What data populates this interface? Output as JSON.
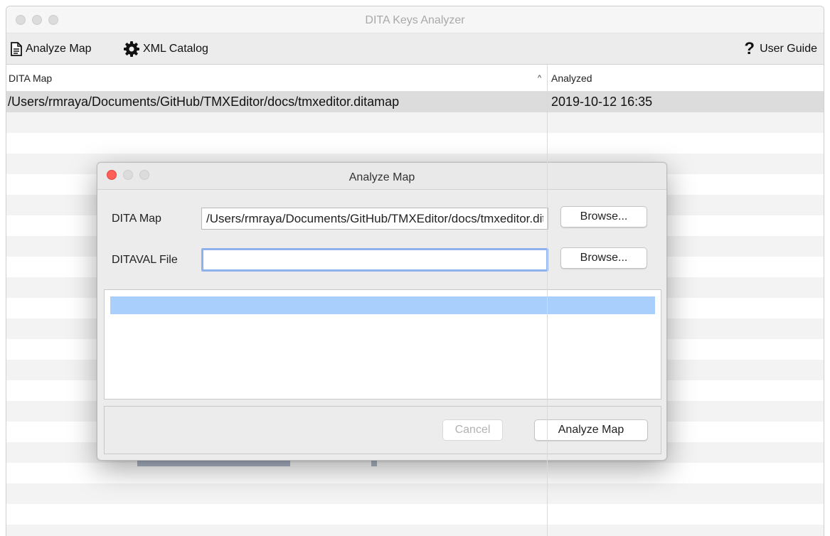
{
  "window": {
    "title": "DITA Keys Analyzer"
  },
  "toolbar": {
    "analyze_map": {
      "label": "Analyze Map",
      "icon": "document-icon"
    },
    "xml_catalog": {
      "label": "XML Catalog",
      "icon": "gear-icon"
    },
    "user_guide": {
      "label": "User Guide",
      "icon": "question-icon"
    }
  },
  "table": {
    "columns": [
      "DITA Map",
      "Analyzed"
    ],
    "sort_indicator": "^",
    "rows": [
      {
        "map": "/Users/rmraya/Documents/GitHub/TMXEditor/docs/tmxeditor.ditamap",
        "analyzed": "2019-10-12 16:35",
        "selected": true
      }
    ]
  },
  "dialog": {
    "title": "Analyze Map",
    "dita_map_label": "DITA Map",
    "dita_map_value": "/Users/rmraya/Documents/GitHub/TMXEditor/docs/tmxeditor.ditamap",
    "ditaval_label": "DITAVAL File",
    "ditaval_value": "",
    "browse_label": "Browse...",
    "cancel_label": "Cancel",
    "analyze_label": "Analyze Map",
    "cancel_enabled": false
  },
  "colors": {
    "close_button": "#fe5f57",
    "focus_ring": "#8fb2ee",
    "log_highlight": "#a9d0fc",
    "selected_row": "#dcdcdc"
  }
}
